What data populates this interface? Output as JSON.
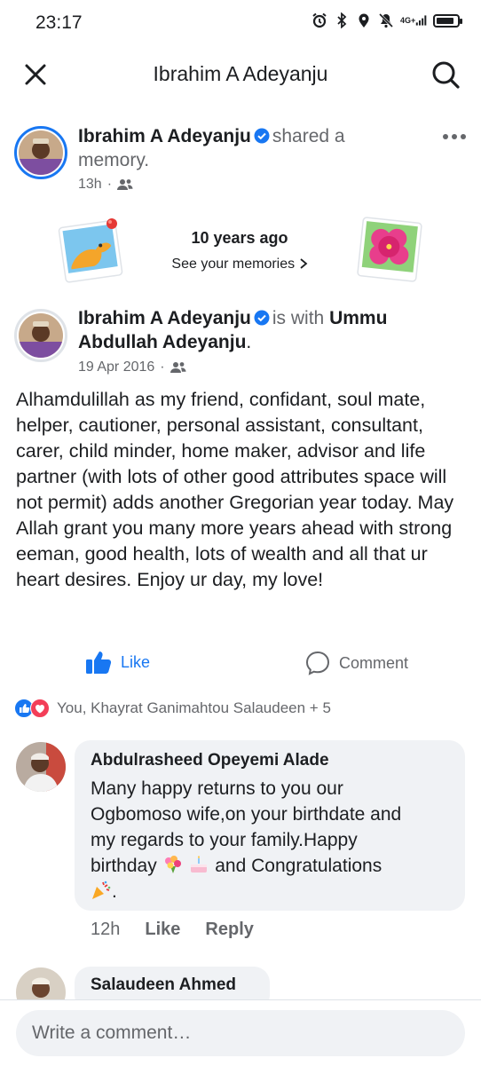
{
  "status": {
    "time": "23:17",
    "network": "4G+"
  },
  "battery_level": 0.85,
  "header": {
    "title": "Ibrahim A Adeyanju"
  },
  "share": {
    "author": "Ibrahim A Adeyanju",
    "action": "shared a",
    "action2": "memory.",
    "time": "13h",
    "dot": "·"
  },
  "memories": {
    "title": "10 years ago",
    "link": "See your memories"
  },
  "post": {
    "author": "Ibrahim A Adeyanju",
    "with_text": "is with",
    "tagged_first": "Ummu",
    "tagged_rest": "Abdullah Adeyanju",
    "period": ".",
    "date": "19 Apr 2016",
    "dot": "·",
    "text": "Alhamdulillah as my friend, confidant, soul mate, helper, cautioner, personal assistant, consultant, carer, child minder, home maker, advisor and life partner (with lots of other good attributes space will not permit) adds another Gregorian year today. May Allah grant you many more years ahead with strong eeman, good health, lots of wealth and all that ur heart desires. Enjoy ur day, my love!"
  },
  "actions": {
    "like": "Like",
    "comment": "Comment"
  },
  "reactions": {
    "summary": "You, Khayrat Ganimahtou Salaudeen + 5"
  },
  "comments": [
    {
      "name": "Abdulrasheed Opeyemi Alade",
      "text_l1": "Many happy returns to you our",
      "text_l2": "Ogbomoso wife,on your birthdate and",
      "text_l3": "my regards to your family.Happy",
      "text_l4a": "birthday",
      "text_l4b": "and Congratulations",
      "text_l5": ".",
      "time": "12h",
      "like": "Like",
      "reply": "Reply"
    },
    {
      "name": "Salaudeen Ahmed"
    }
  ],
  "composer": {
    "placeholder": "Write a comment…"
  },
  "colors": {
    "brand": "#1877f2",
    "love": "#f33e58",
    "text": "#1c1e21",
    "muted": "#65676b",
    "bubble": "#f0f2f5"
  }
}
